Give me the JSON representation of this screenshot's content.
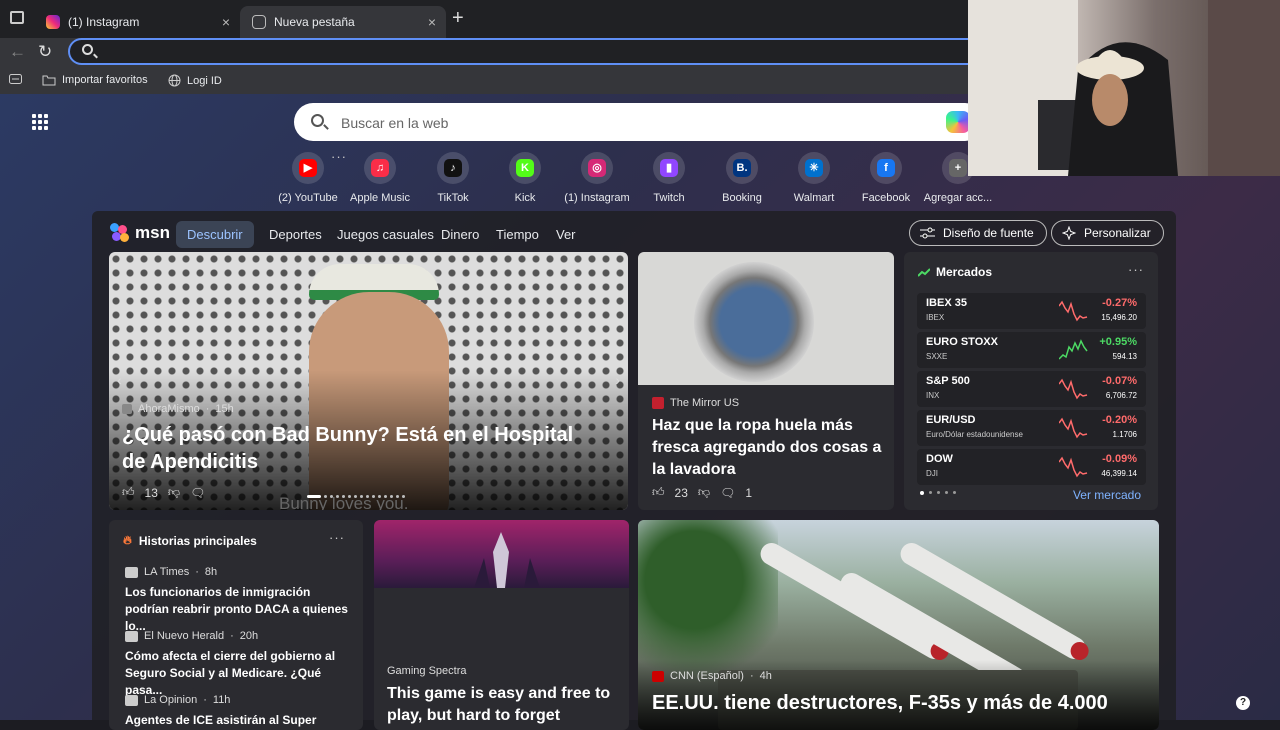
{
  "browser": {
    "tabs": [
      {
        "title": "(1) Instagram",
        "close_icon": "×"
      },
      {
        "title": "Nueva pestaña",
        "close_icon": "×"
      }
    ],
    "new_tab": "+",
    "bookmarks": [
      {
        "label": "Importar favoritos"
      },
      {
        "label": "Logi ID"
      }
    ]
  },
  "search": {
    "placeholder": "Buscar en la web"
  },
  "shortcuts": [
    {
      "label": "(2) YouTube",
      "color": "#ff0000",
      "glyph": "▶"
    },
    {
      "label": "Apple Music",
      "color": "#fa2d48",
      "glyph": "♫"
    },
    {
      "label": "TikTok",
      "color": "#111111",
      "glyph": "♪"
    },
    {
      "label": "Kick",
      "color": "#53fc18",
      "glyph": "K"
    },
    {
      "label": "(1) Instagram",
      "color": "#d62976",
      "glyph": "◎"
    },
    {
      "label": "Twitch",
      "color": "#9146ff",
      "glyph": "▮"
    },
    {
      "label": "Booking",
      "color": "#003580",
      "glyph": "B."
    },
    {
      "label": "Walmart",
      "color": "#0071ce",
      "glyph": "✳"
    },
    {
      "label": "Facebook",
      "color": "#1877f2",
      "glyph": "f"
    },
    {
      "label": "Agregar acc...",
      "color": "#666666",
      "glyph": "+"
    }
  ],
  "msn": {
    "logo": "msn",
    "tabs": [
      "Descubrir",
      "Deportes",
      "Juegos casuales",
      "Dinero",
      "Tiempo",
      "Ver"
    ],
    "font_button": "Diseño de fuente",
    "customize_button": "Personalizar"
  },
  "hero": {
    "source": "AhoraMismo",
    "time": "15h",
    "headline": "¿Qué pasó con Bad Bunny? Está en el Hospital de Apendicitis",
    "likes": "13",
    "caption": "Bunny loves you."
  },
  "wash": {
    "source": "The Mirror US",
    "headline": "Haz que la ropa huela más fresca agregando dos cosas a la lavadora",
    "likes": "23",
    "comments": "1"
  },
  "markets": {
    "title": "Mercados",
    "link": "Ver mercado",
    "rows": [
      {
        "name": "IBEX 35",
        "symbol": "IBEX",
        "change": "-0.27%",
        "price": "15,496.20",
        "trend": "down"
      },
      {
        "name": "EURO STOXX",
        "symbol": "SXXE",
        "change": "+0.95%",
        "price": "594.13",
        "trend": "up"
      },
      {
        "name": "S&P 500",
        "symbol": "INX",
        "change": "-0.07%",
        "price": "6,706.72",
        "trend": "down"
      },
      {
        "name": "EUR/USD",
        "symbol": "Euro/Dólar estadounidense",
        "change": "-0.20%",
        "price": "1.1706",
        "trend": "down"
      },
      {
        "name": "DOW",
        "symbol": "DJI",
        "change": "-0.09%",
        "price": "46,399.14",
        "trend": "down"
      }
    ]
  },
  "historias": {
    "title": "Historias principales",
    "items": [
      {
        "source": "LA Times",
        "time": "8h",
        "title": "Los funcionarios de inmigración podrían reabrir pronto DACA a quienes lo..."
      },
      {
        "source": "El Nuevo Herald",
        "time": "20h",
        "title": "Cómo afecta el cierre del gobierno al Seguro Social y al Medicare. ¿Qué pasa..."
      },
      {
        "source": "La Opinion",
        "time": "11h",
        "title": "Agentes de ICE asistirán al Super Bowl..."
      }
    ]
  },
  "game": {
    "source": "Gaming Spectra",
    "headline": "This game is easy and free to play, but hard to forget"
  },
  "news": {
    "source": "CNN (Español)",
    "time": "4h",
    "headline": "EE.UU. tiene destructores, F-35s y más de 4.000"
  },
  "colors": {
    "up": "#4cd964",
    "down": "#ff6b6b",
    "accent": "#9cc3ff",
    "link": "#7fb3ff"
  }
}
